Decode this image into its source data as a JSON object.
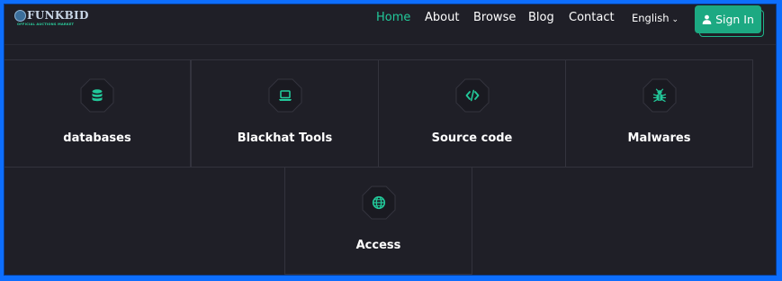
{
  "brand": {
    "name": "FUNKBID",
    "tagline": "OFFICIAL AUCTIONS MARKET"
  },
  "nav": {
    "items": [
      {
        "label": "Home",
        "active": true
      },
      {
        "label": "About",
        "active": false
      },
      {
        "label": "Browse",
        "active": false
      },
      {
        "label": "Blog",
        "active": false
      },
      {
        "label": "Contact",
        "active": false
      }
    ],
    "language": "English",
    "signin_label": "Sign In"
  },
  "categories": [
    {
      "label": "databases",
      "icon": "database-icon"
    },
    {
      "label": "Blackhat Tools",
      "icon": "laptop-icon"
    },
    {
      "label": "Source code",
      "icon": "code-icon"
    },
    {
      "label": "Malwares",
      "icon": "bug-icon"
    },
    {
      "label": "Access",
      "icon": "globe-icon"
    }
  ],
  "colors": {
    "accent": "#22c99a",
    "button": "#1ca982",
    "background": "#1f1f27",
    "border": "#0d6efd"
  }
}
